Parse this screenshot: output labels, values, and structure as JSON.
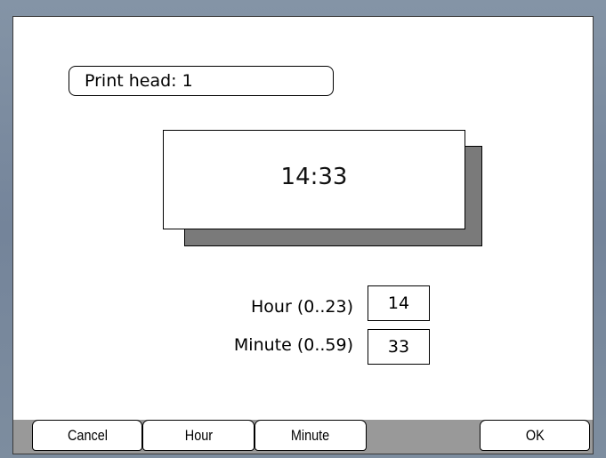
{
  "print_head": {
    "label": "Print head: 1"
  },
  "clock": {
    "time": "14:33"
  },
  "fields": {
    "hour": {
      "label": "Hour (0..23)",
      "value": "14"
    },
    "minute": {
      "label": "Minute (0..59)",
      "value": "33"
    }
  },
  "softkeys": {
    "cancel": "Cancel",
    "hour": "Hour",
    "minute": "Minute",
    "empty": "",
    "ok": "OK"
  },
  "colors": {
    "frame": "#7a8a9c",
    "screen": "#ffffff",
    "shadow": "#7a7a7a",
    "softkey_bar": "#999999"
  }
}
